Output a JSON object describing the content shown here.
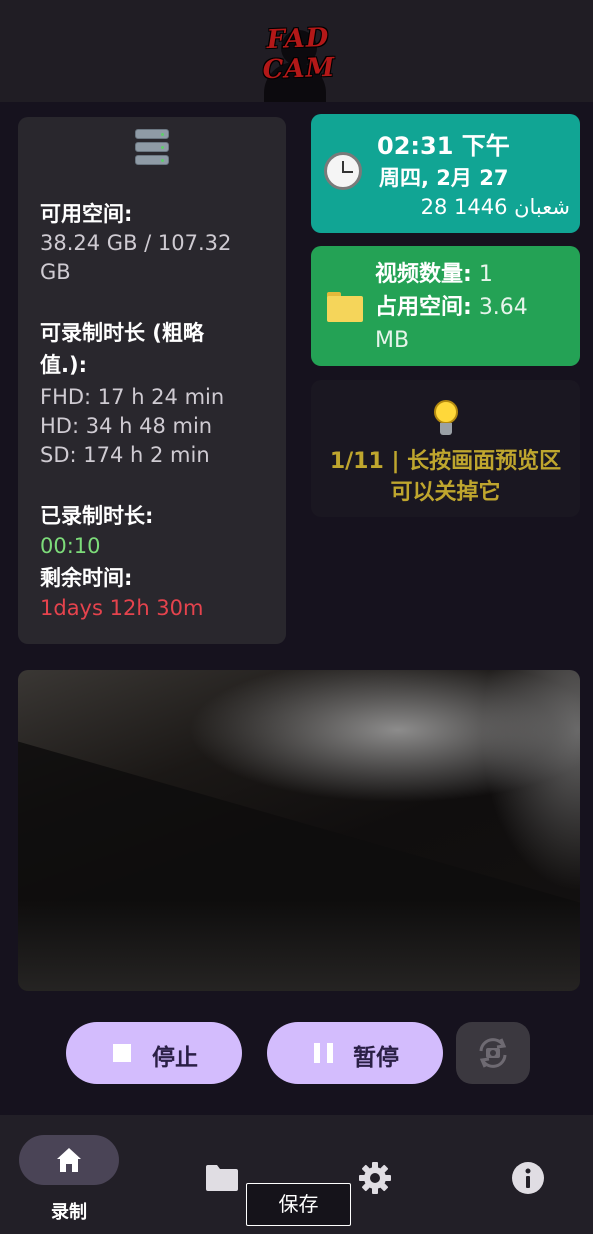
{
  "header": {
    "logo_text": "FAD CAM"
  },
  "storage": {
    "icon": "database-icon",
    "available_label": "可用空间:",
    "available_value_line1": "38.24 GB / 107.32",
    "available_value_line2": "GB",
    "record_time_label_line1": "可录制时长 (粗略",
    "record_time_label_line2": "值.):",
    "fhd": "FHD: 17 h 24 min",
    "hd": "HD: 34 h 48 min",
    "sd": "SD: 174 h 2 min",
    "recorded_label": "已录制时长:",
    "recorded_value": "00:10",
    "remaining_label": "剩余时间:",
    "remaining_value": "1days 12h 30m",
    "colors": {
      "recorded": "#7ddc7a",
      "remaining": "#e5434d"
    }
  },
  "clock": {
    "icon": "alarm-clock-icon",
    "time": "02:31 下午",
    "date": "周四, 2月 27",
    "hijri": "28 شعبان 1446",
    "color": "#11a594"
  },
  "videos": {
    "icon": "folder-icon",
    "count_label": "视频数量:",
    "count_value": "1",
    "space_label": "占用空间:",
    "space_value_line1": "3.64",
    "space_value_line2": "MB",
    "color": "#24a255"
  },
  "tip": {
    "icon": "lightbulb-icon",
    "line1": "1/11 | 长按画面预览区",
    "line2": "可以关掉它",
    "color": "#bfa62e"
  },
  "controls": {
    "stop_label": "停止",
    "pause_label": "暂停",
    "switch_camera_icon": "camera-switch-icon",
    "accent": "#d3bcfd"
  },
  "nav": {
    "items": [
      {
        "icon": "home-icon",
        "label": "录制",
        "selected": true
      },
      {
        "icon": "folder-icon",
        "label": ""
      },
      {
        "icon": "gear-icon",
        "label": ""
      },
      {
        "icon": "info-icon",
        "label": ""
      }
    ]
  },
  "toast": {
    "text": "保存"
  }
}
